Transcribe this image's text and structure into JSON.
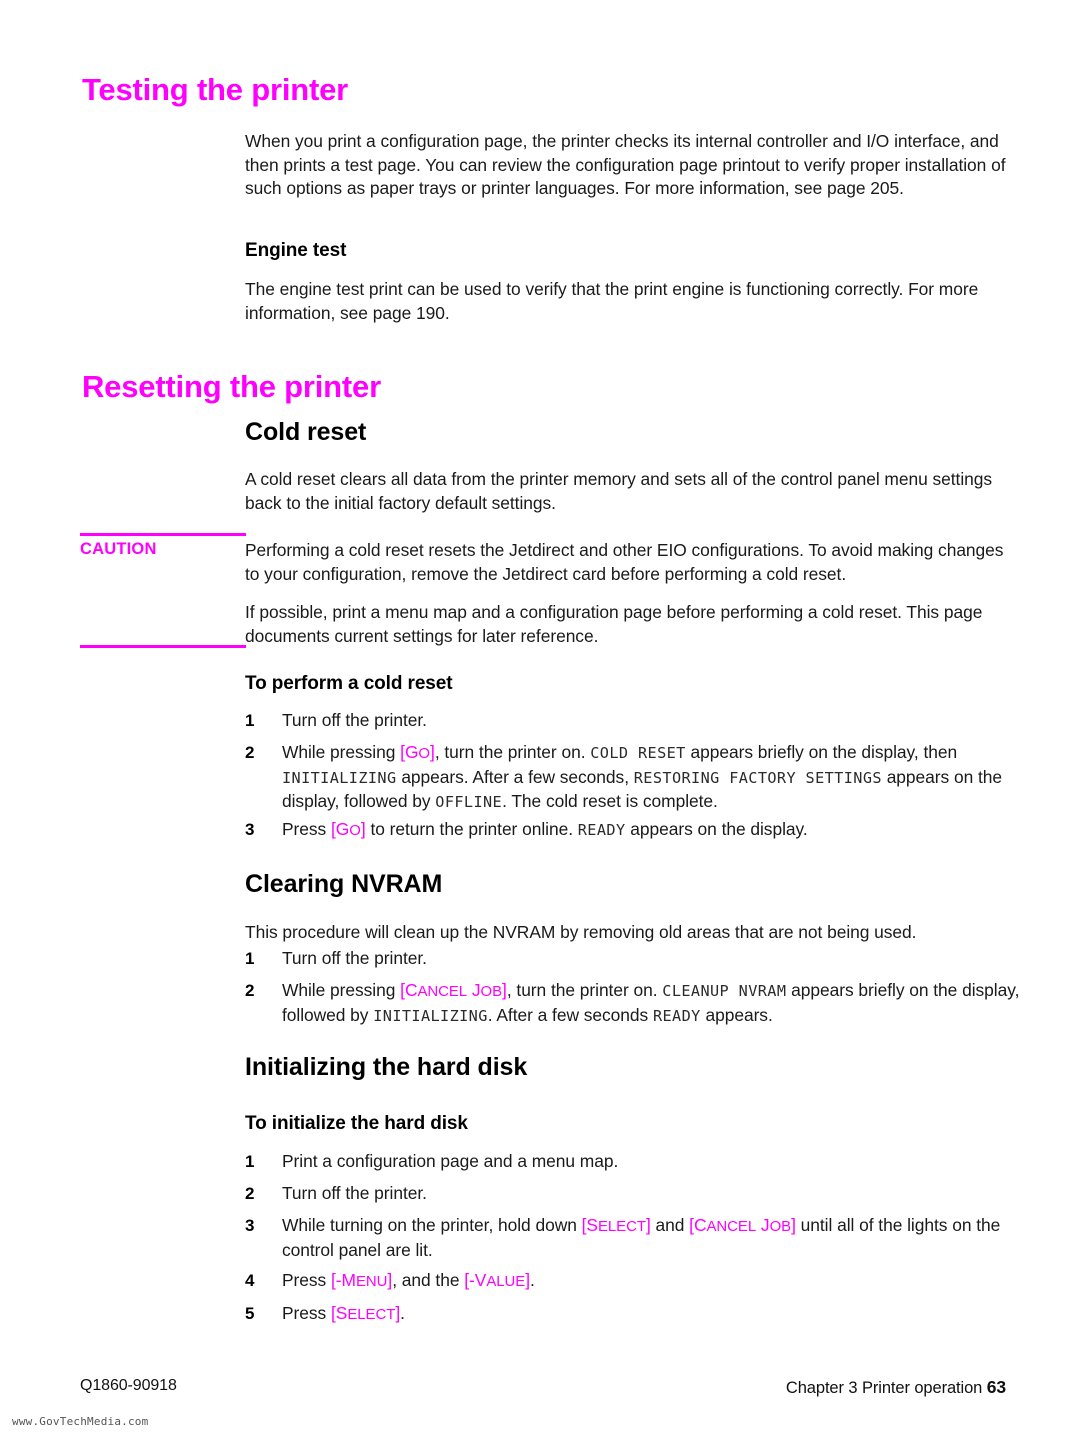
{
  "document": {
    "accent_color": "#ff00ff",
    "text_color": "#000000",
    "background_color": "#ffffff"
  },
  "sections": {
    "testing": {
      "title": "Testing the printer",
      "intro": "When you print a configuration page, the printer checks its internal controller and I/O interface, and then prints a test page. You can review the configuration page printout to verify proper installation of such options as paper trays or printer languages. For more information, see page 205.",
      "engine_test": {
        "heading": "Engine test",
        "body": "The engine test print can be used to verify that the print engine is functioning correctly. For more information, see page 190."
      }
    },
    "resetting": {
      "title": "Resetting the printer",
      "cold_reset": {
        "heading": "Cold reset",
        "body": "A cold reset clears all data from the printer memory and sets all of the control panel menu settings back to the initial factory default settings.",
        "caution_label": "CAUTION",
        "caution_body": "Performing a cold reset resets the Jetdirect and other EIO configurations. To avoid making changes to your configuration, remove the Jetdirect card before performing a cold reset.",
        "caution_note": "If possible, print a menu map and a configuration page before performing a cold reset. This page documents current settings for later reference.",
        "procedure_heading": "To perform a cold reset",
        "steps": [
          {
            "num": "1",
            "parts": [
              {
                "type": "text",
                "value": "Turn off the printer."
              }
            ]
          },
          {
            "num": "2",
            "parts": [
              {
                "type": "text",
                "value": "While pressing "
              },
              {
                "type": "key",
                "value": "[Go]"
              },
              {
                "type": "text",
                "value": ", turn the printer on. "
              },
              {
                "type": "lcd",
                "value": "COLD RESET"
              },
              {
                "type": "text",
                "value": " appears briefly on the display, then "
              },
              {
                "type": "lcd",
                "value": "INITIALIZING"
              },
              {
                "type": "text",
                "value": " appears. After a few seconds, "
              },
              {
                "type": "lcd",
                "value": "RESTORING FACTORY SETTINGS"
              },
              {
                "type": "text",
                "value": " appears on the display, followed by "
              },
              {
                "type": "lcd",
                "value": "OFFLINE"
              },
              {
                "type": "text",
                "value": ". The cold reset is complete."
              }
            ]
          },
          {
            "num": "3",
            "parts": [
              {
                "type": "text",
                "value": "Press "
              },
              {
                "type": "key",
                "value": "[Go]"
              },
              {
                "type": "text",
                "value": " to return the printer online. "
              },
              {
                "type": "lcd",
                "value": "READY"
              },
              {
                "type": "text",
                "value": " appears on the display."
              }
            ]
          }
        ]
      },
      "clearing_nvram": {
        "heading": "Clearing NVRAM",
        "body": "This procedure will clean up the NVRAM by removing old areas that are not being used.",
        "steps": [
          {
            "num": "1",
            "parts": [
              {
                "type": "text",
                "value": "Turn off the printer."
              }
            ]
          },
          {
            "num": "2",
            "parts": [
              {
                "type": "text",
                "value": "While pressing "
              },
              {
                "type": "key",
                "value": "[Cancel Job]"
              },
              {
                "type": "text",
                "value": ", turn the printer on. "
              },
              {
                "type": "lcd",
                "value": "CLEANUP NVRAM"
              },
              {
                "type": "text",
                "value": " appears briefly on the display, followed by "
              },
              {
                "type": "lcd",
                "value": "INITIALIZING"
              },
              {
                "type": "text",
                "value": ". After a few seconds "
              },
              {
                "type": "lcd",
                "value": "READY"
              },
              {
                "type": "text",
                "value": " appears."
              }
            ]
          }
        ]
      },
      "initializing_hard_disk": {
        "heading": "Initializing the hard disk",
        "procedure_heading": "To initialize the hard disk",
        "steps": [
          {
            "num": "1",
            "parts": [
              {
                "type": "text",
                "value": "Print a configuration page and a menu map."
              }
            ]
          },
          {
            "num": "2",
            "parts": [
              {
                "type": "text",
                "value": "Turn off the printer."
              }
            ]
          },
          {
            "num": "3",
            "parts": [
              {
                "type": "text",
                "value": "While turning on the printer, hold down "
              },
              {
                "type": "key",
                "value": "[Select]"
              },
              {
                "type": "text",
                "value": " and "
              },
              {
                "type": "key",
                "value": "[Cancel Job]"
              },
              {
                "type": "text",
                "value": " until all of the lights on the control panel are lit."
              }
            ]
          },
          {
            "num": "4",
            "parts": [
              {
                "type": "text",
                "value": "Press "
              },
              {
                "type": "key",
                "value": "[-Menu]"
              },
              {
                "type": "text",
                "value": ", and the "
              },
              {
                "type": "key",
                "value": "[-Value]"
              },
              {
                "type": "text",
                "value": "."
              }
            ]
          },
          {
            "num": "5",
            "parts": [
              {
                "type": "text",
                "value": "Press "
              },
              {
                "type": "key",
                "value": "[Select]"
              },
              {
                "type": "text",
                "value": "."
              }
            ]
          }
        ]
      }
    }
  },
  "footer": {
    "part_number": "Q1860-90918",
    "chapter": "Chapter 3 Printer operation",
    "page_number": "63",
    "watermark": "www.GovTechMedia.com"
  }
}
